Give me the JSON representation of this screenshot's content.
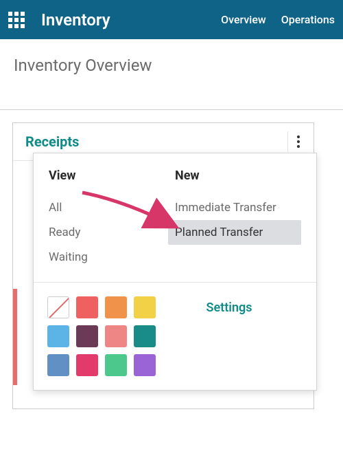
{
  "topbar": {
    "app_title": "Inventory",
    "nav": [
      "Overview",
      "Operations"
    ]
  },
  "page": {
    "title": "Inventory Overview"
  },
  "card": {
    "title": "Receipts"
  },
  "dropdown": {
    "view": {
      "heading": "View",
      "items": [
        "All",
        "Ready",
        "Waiting"
      ]
    },
    "new": {
      "heading": "New",
      "items": [
        "Immediate Transfer",
        "Planned Transfer"
      ]
    },
    "settings": "Settings",
    "colors": [
      "none",
      "#ef6161",
      "#f0924a",
      "#f2d146",
      "#5cb4e6",
      "#6b3a56",
      "#ef8686",
      "#1a8c88",
      "#6090c4",
      "#e23a6b",
      "#4cc88c",
      "#9a63d6"
    ]
  }
}
